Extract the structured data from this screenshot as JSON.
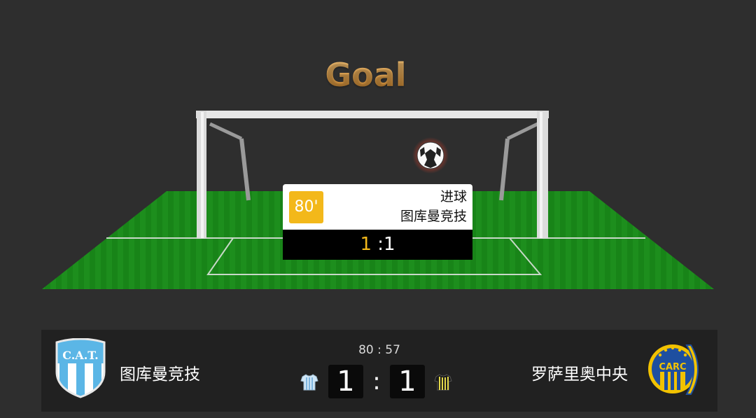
{
  "banner": {
    "title": "Goal"
  },
  "event_popup": {
    "minute": "80'",
    "event_type": "进球",
    "team": "图库曼竞技",
    "score_home": "1",
    "score_away": ":1"
  },
  "scoreboard": {
    "clock": "80 : 57",
    "home": {
      "name": "图库曼竞技",
      "score": "1",
      "crest_text": "C.A.T."
    },
    "away": {
      "name": "罗萨里奥中央",
      "score": "1",
      "crest_text": "CARC"
    },
    "separator": ":"
  },
  "colors": {
    "background": "#2e2e2e",
    "pitch": "#1c8a1c",
    "accent_gold": "#f3b81a",
    "home_crest_blue": "#5bb6e6",
    "away_crest_blue": "#1e4fa0",
    "away_crest_yellow": "#f2c200"
  },
  "icons": [
    "soccer-ball-icon",
    "home-shirt-icon",
    "away-shirt-icon"
  ]
}
